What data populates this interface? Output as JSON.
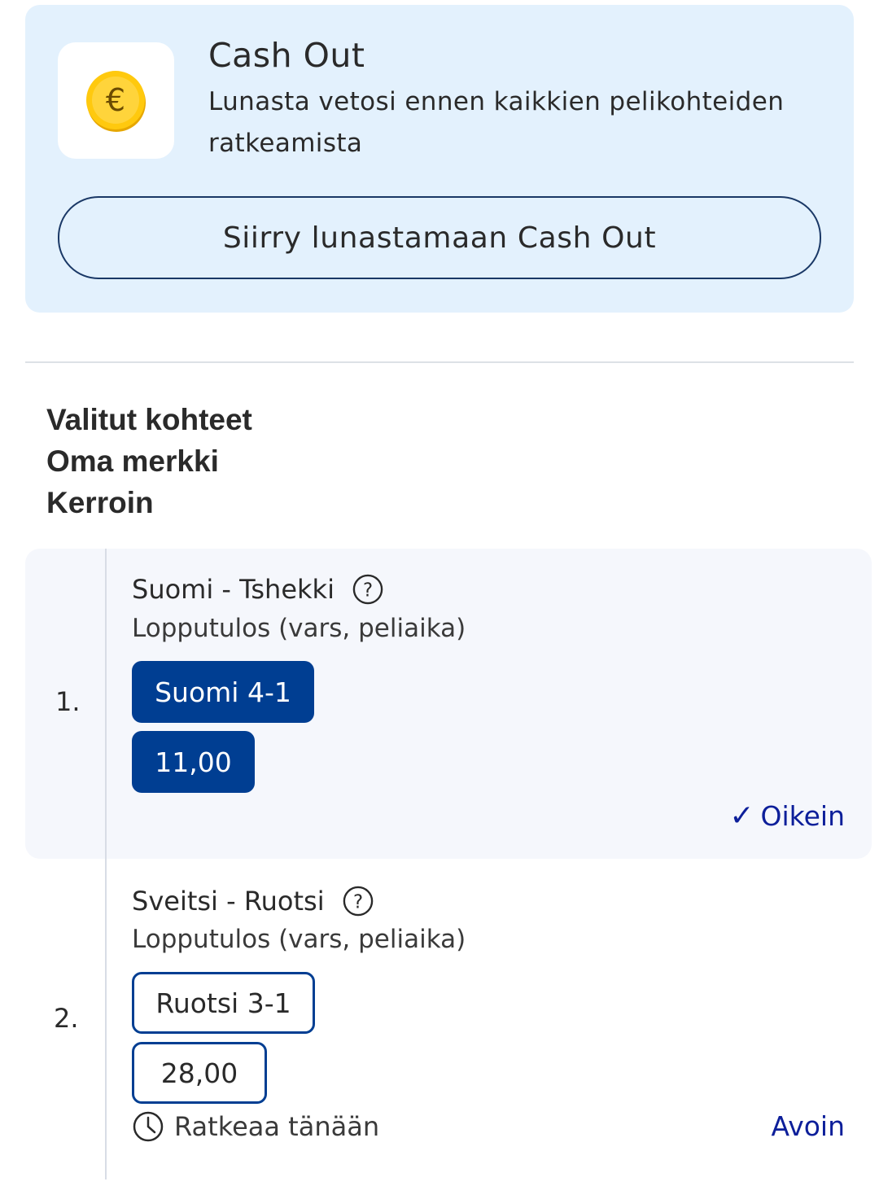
{
  "cashout": {
    "title": "Cash Out",
    "description": "Lunasta vetosi ennen kaikkien pelikohteiden ratkeamista",
    "button_label": "Siirry lunastamaan Cash Out",
    "coin_icon": "euro-coin-icon"
  },
  "headers": {
    "line1": "Valitut kohteet",
    "line2": "Oma merkki",
    "line3": "Kerroin"
  },
  "selections": [
    {
      "number": "1.",
      "match": "Suomi - Tshekki",
      "market": "Lopputulos (vars, peliaika)",
      "pick": "Suomi 4-1",
      "odds": "11,00",
      "status_mark": "✓",
      "status": "Oikein"
    },
    {
      "number": "2.",
      "match": "Sveitsi - Ruotsi",
      "market": "Lopputulos (vars, peliaika)",
      "pick": "Ruotsi 3-1",
      "odds": "28,00",
      "resolve_text": "Ratkeaa tänään",
      "status": "Avoin"
    }
  ],
  "colors": {
    "card_bg": "#e3f1fd",
    "accent": "#003e92",
    "status_text": "#0d1f9a"
  }
}
